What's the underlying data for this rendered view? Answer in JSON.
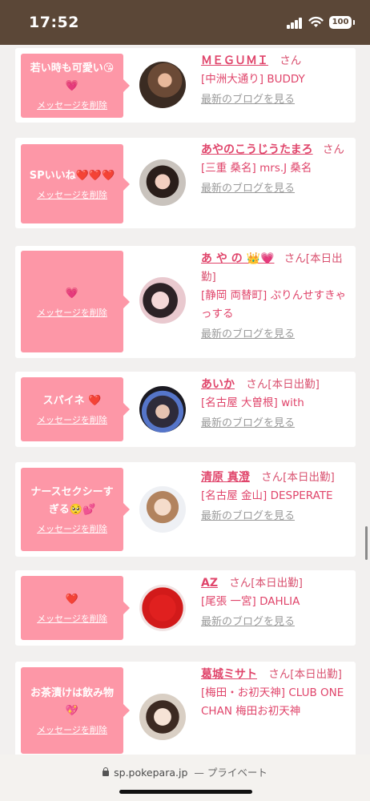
{
  "status": {
    "time": "17:52",
    "battery": "100"
  },
  "items": [
    {
      "message": "若い時も可愛い😘💗",
      "delete_label": "メッセージを削除",
      "name": "ＭＥＧＵＭＩ",
      "san": "さん",
      "shop": "[中洲大通り] BUDDY",
      "blog": "最新のブログを見る"
    },
    {
      "message": "SPいいね❤️❤️❤️",
      "delete_label": "メッセージを削除",
      "name": "あやのこうじうたまろ",
      "san": "さん",
      "shop": "[三重 桑名] mrs.J 桑名",
      "blog": "最新のブログを見る"
    },
    {
      "message": "💗",
      "delete_label": "メッセージを削除",
      "name": "あ や の 👑💗",
      "san": "さん[本日出勤]",
      "shop": "[静岡 両替町] ぷりんせすきゃっする",
      "blog": "最新のブログを見る"
    },
    {
      "message": "スパイネ ❤️",
      "delete_label": "メッセージを削除",
      "name": "あいか",
      "san": "さん[本日出勤]",
      "shop": "[名古屋 大曽根] with",
      "blog": "最新のブログを見る"
    },
    {
      "message": "ナースセクシーすぎる🥺💕",
      "delete_label": "メッセージを削除",
      "name": "清原 真澄",
      "san": "さん[本日出勤]",
      "shop": "[名古屋 金山] DESPERATE",
      "blog": "最新のブログを見る"
    },
    {
      "message": "❤️",
      "delete_label": "メッセージを削除",
      "name": "AZ",
      "san": "さん[本日出勤]",
      "shop": "[尾張 一宮] DAHLIA",
      "blog": "最新のブログを見る"
    },
    {
      "message": "お茶漬けは飲み物💖",
      "delete_label": "メッセージを削除",
      "name": "葛城ミサト",
      "san": "さん[本日出勤]",
      "shop": "[梅田・お初天神] CLUB ONE CHAN 梅田お初天神",
      "blog": ""
    }
  ],
  "browser": {
    "url": "sp.pokepara.jp",
    "mode": "— プライベート"
  },
  "colors": {
    "accent": "#e0456b",
    "bubble": "#fd97a7",
    "statusbar": "#5b4737"
  }
}
